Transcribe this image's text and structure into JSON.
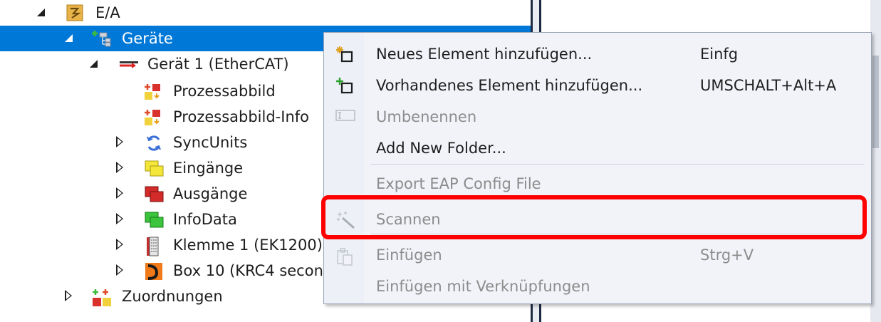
{
  "tree": {
    "root": {
      "label": "E/A",
      "expanded": true
    },
    "devices": {
      "label": "Geräte",
      "expanded": true,
      "selected": true
    },
    "device1": {
      "label": "Gerät 1 (EtherCAT)",
      "expanded": true
    },
    "children": [
      {
        "label": "Prozessabbild",
        "icon": "process-image-icon",
        "expandable": false
      },
      {
        "label": "Prozessabbild-Info",
        "icon": "process-image-info-icon",
        "expandable": false
      },
      {
        "label": "SyncUnits",
        "icon": "sync-units-icon",
        "expandable": true
      },
      {
        "label": "Eingänge",
        "icon": "inputs-icon",
        "expandable": true
      },
      {
        "label": "Ausgänge",
        "icon": "outputs-icon",
        "expandable": true
      },
      {
        "label": "InfoData",
        "icon": "infodata-icon",
        "expandable": true
      },
      {
        "label": "Klemme 1 (EK1200)",
        "icon": "terminal-icon",
        "expandable": true
      },
      {
        "label": "Box 10 (KRC4 secon",
        "icon": "box-icon",
        "expandable": true
      }
    ],
    "mappings": {
      "label": "Zuordnungen",
      "expanded": false
    }
  },
  "context_menu": {
    "items": [
      {
        "label": "Neues Element hinzufügen...",
        "shortcut": "Einfg",
        "enabled": true,
        "icon": "new-element-icon"
      },
      {
        "label": "Vorhandenes Element hinzufügen...",
        "shortcut": "UMSCHALT+Alt+A",
        "enabled": true,
        "icon": "existing-element-icon"
      },
      {
        "label": "Umbenennen",
        "shortcut": "",
        "enabled": false,
        "icon": "rename-icon"
      },
      {
        "label": "Add New Folder...",
        "shortcut": "",
        "enabled": true,
        "icon": ""
      },
      {
        "label": "Export EAP Config File",
        "shortcut": "",
        "enabled": false,
        "icon": ""
      },
      {
        "label": "Scannen",
        "shortcut": "",
        "enabled": false,
        "icon": "scan-wand-icon",
        "highlighted": true
      },
      {
        "label": "Einfügen",
        "shortcut": "Strg+V",
        "enabled": false,
        "icon": "paste-icon"
      },
      {
        "label": "Einfügen mit Verknüpfungen",
        "shortcut": "",
        "enabled": false,
        "icon": ""
      }
    ]
  },
  "colors": {
    "selection": "#0078d7",
    "highlight_border": "#ff0000",
    "disabled_text": "#8c8c8c"
  }
}
